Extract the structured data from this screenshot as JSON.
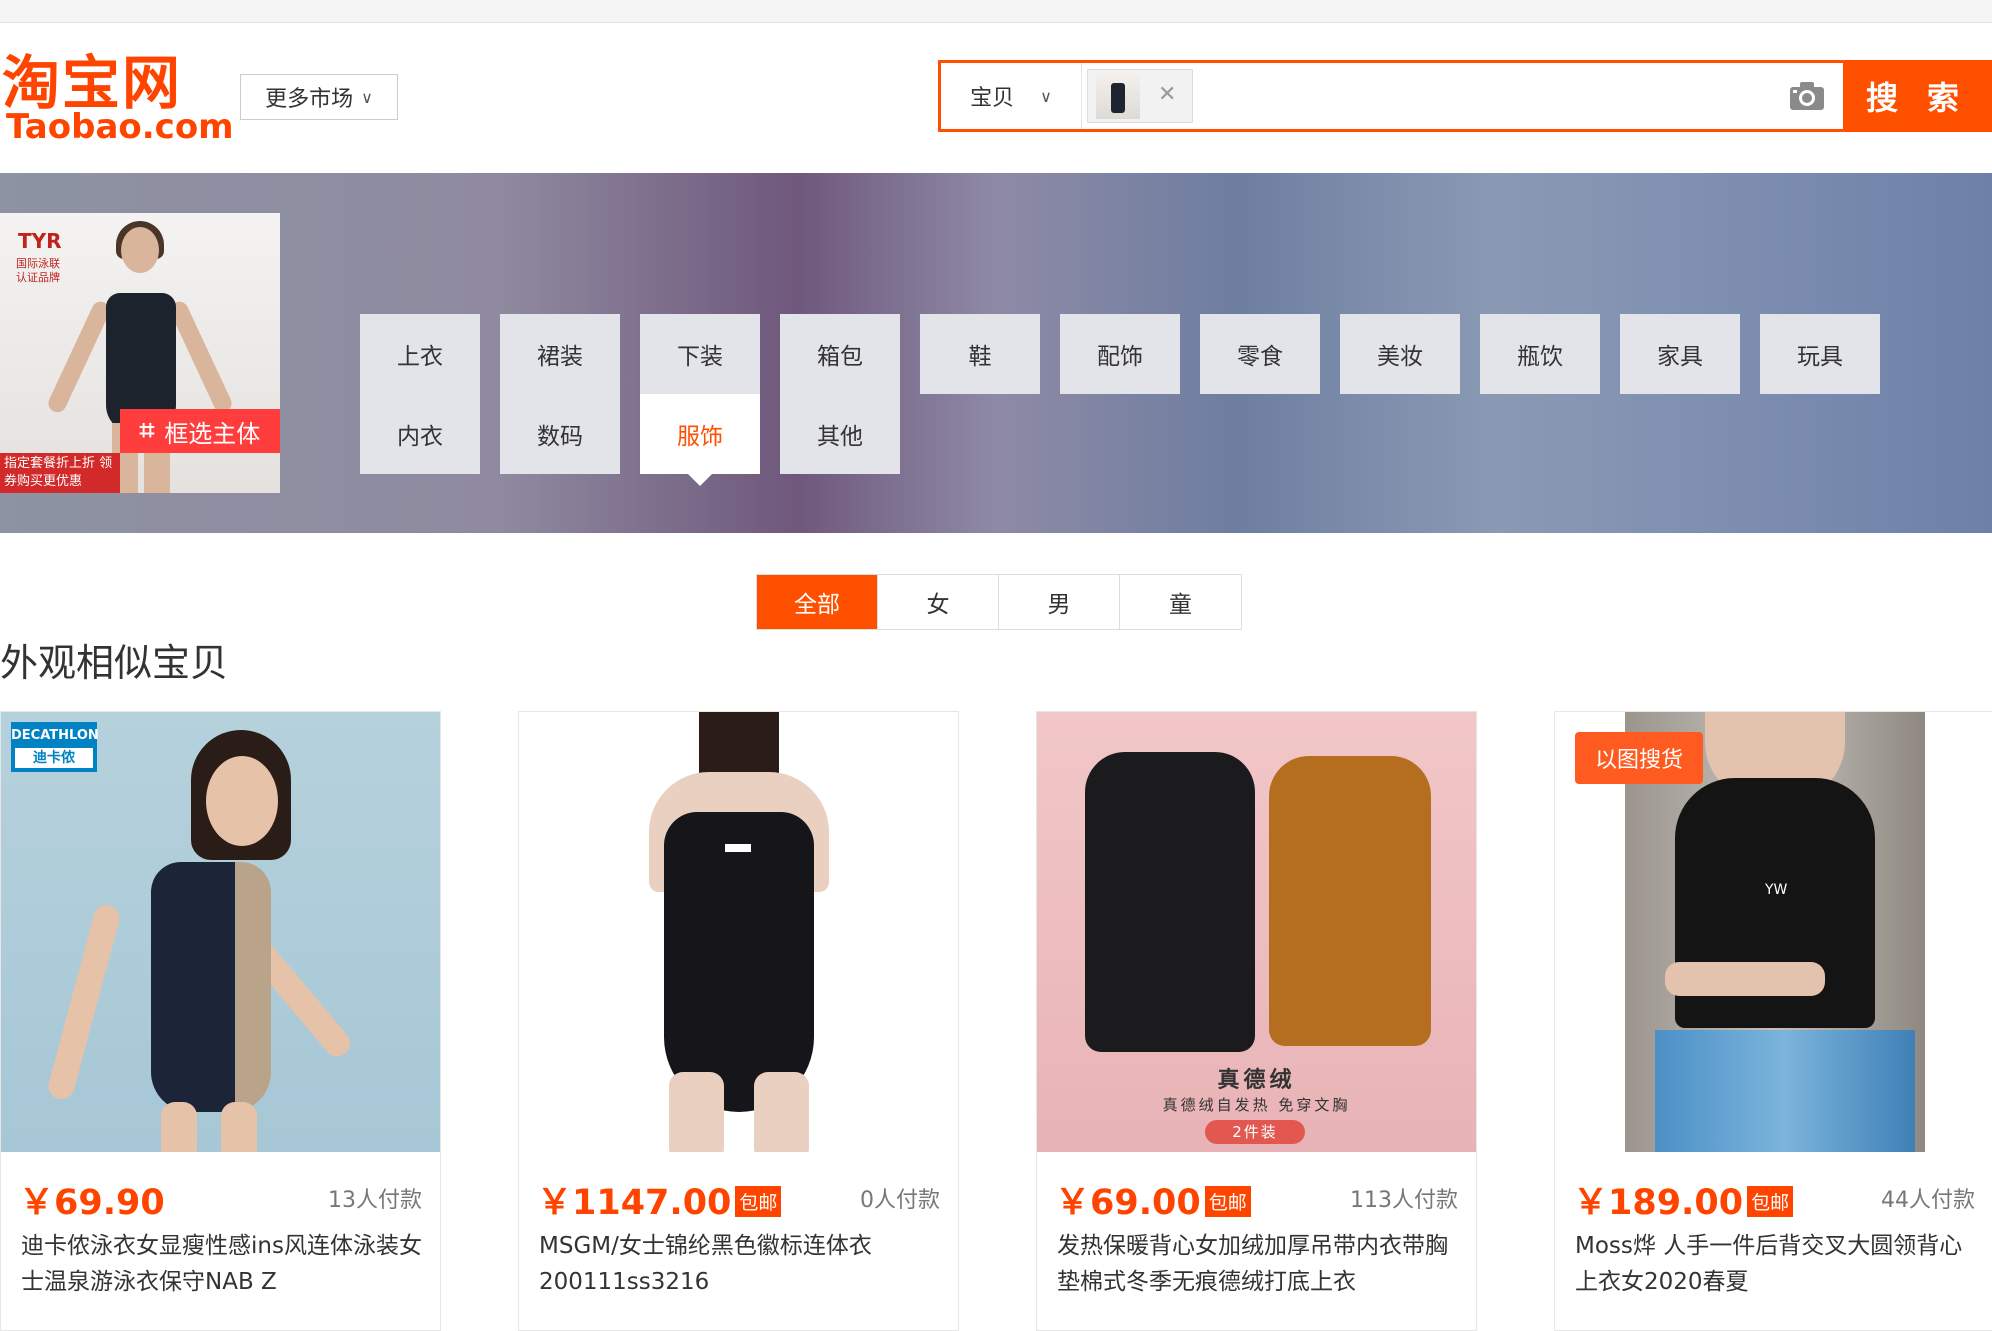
{
  "header": {
    "logo_cn": "淘宝网",
    "logo_en": "Taobao.com",
    "market_label": "更多市场",
    "search": {
      "category": "宝贝",
      "placeholder": "",
      "button_label": "搜 索"
    }
  },
  "banner": {
    "crop_button": "框选主体",
    "crop_image_brand": "TYR",
    "crop_image_badge": "国际泳联认证品牌",
    "crop_image_promo": "指定套餐折上折 领券购买更优惠",
    "categories": [
      "上衣",
      "裙装",
      "下装",
      "箱包",
      "鞋",
      "配饰",
      "零食",
      "美妆",
      "瓶饮",
      "家具",
      "玩具",
      "内衣",
      "数码",
      "服饰",
      "其他"
    ],
    "active_category": "服饰"
  },
  "filters": {
    "tabs": [
      "全部",
      "女",
      "男",
      "童"
    ],
    "active": "全部"
  },
  "section_title": "外观相似宝贝",
  "products": [
    {
      "price": "￥69.90",
      "free_shipping": "",
      "paid": "13人付款",
      "title": "迪卡侬泳衣女显瘦性感ins风连体泳装女士温泉游泳衣保守NAB Z",
      "brand_logo": "DECATHLON",
      "brand_logo_cn": "迪卡侬"
    },
    {
      "price": "￥1147.00",
      "free_shipping": "包邮",
      "paid": "0人付款",
      "title": "MSGM/女士锦纶黑色徽标连体衣200111ss3216"
    },
    {
      "price": "￥69.00",
      "free_shipping": "包邮",
      "paid": "113人付款",
      "title": "发热保暖背心女加绒加厚吊带内衣带胸垫棉式冬季无痕德绒打底上衣",
      "img_title": "真德绒",
      "img_sub": "真德绒自发热 免穿文胸",
      "img_pill": "2件装"
    },
    {
      "price": "￥189.00",
      "free_shipping": "包邮",
      "paid": "44人付款",
      "title": "Moss烨 人手一件后背交叉大圆领背心上衣女2020春夏",
      "img_tag": "以图搜货",
      "img_text": "YW"
    }
  ],
  "colors": {
    "accent": "#ff5000",
    "price": "#ff4400"
  }
}
